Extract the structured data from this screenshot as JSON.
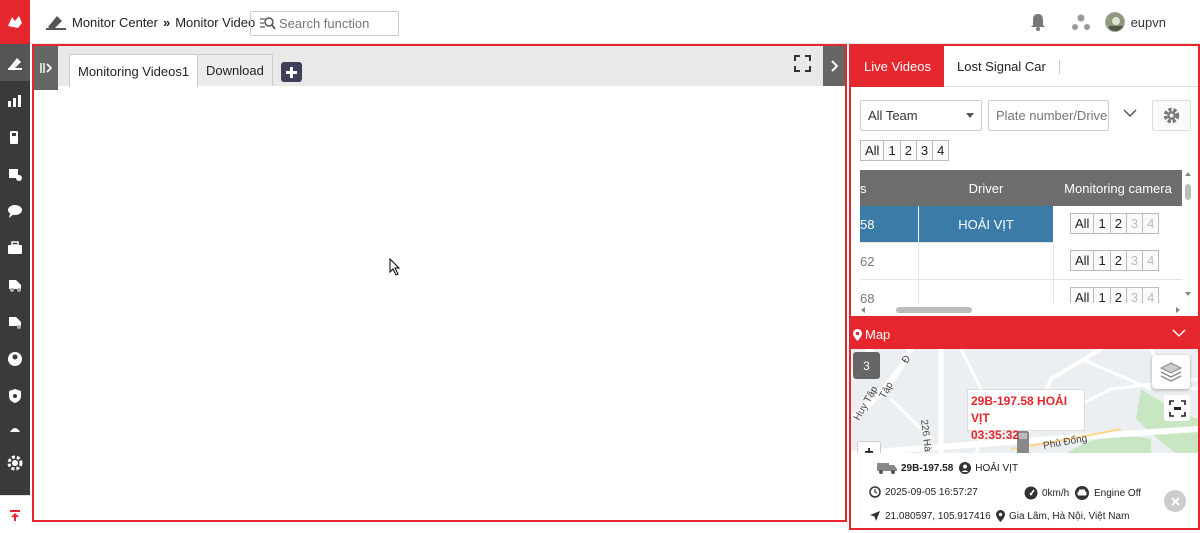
{
  "breadcrumb": {
    "section": "Monitor Center",
    "separator": "»",
    "page": "Monitor Video"
  },
  "search": {
    "placeholder": "Search function"
  },
  "user": {
    "name": "eupvn"
  },
  "main": {
    "tabs": [
      {
        "label": "Monitoring Videos1"
      },
      {
        "label": "Download"
      }
    ]
  },
  "live": {
    "tabs": [
      {
        "label": "Live Videos"
      },
      {
        "label": "Lost Signal Car"
      }
    ],
    "team_select": "All Team",
    "plate_placeholder": "Plate number/Driver",
    "channel_filters": [
      "All",
      "1",
      "2",
      "3",
      "4"
    ],
    "columns": {
      "id": "s",
      "driver": "Driver",
      "camera": "Monitoring camera"
    },
    "rows": [
      {
        "id": "58",
        "driver": "HOẢI VỊT",
        "selected": true
      },
      {
        "id": "62",
        "driver": "",
        "selected": false
      },
      {
        "id": "68",
        "driver": "",
        "selected": false
      }
    ],
    "camera_buttons": [
      "All",
      "1",
      "2",
      "3",
      "4"
    ]
  },
  "map": {
    "title": "Map",
    "cluster_count": "3",
    "street_labels": [
      "226 Hà Huy Tập",
      "Huy Tập",
      "Phù Đổng",
      "Tập",
      "Đ"
    ],
    "popup": {
      "line1": "29B-197.58 HOẢI VỊT",
      "line2": "03:35:32"
    },
    "zoom_in": "+",
    "zoom_out": "−",
    "vehicle": {
      "plate": "29B-197.58",
      "driver": "HOẢI VỊT",
      "datetime": "2025-09-05 16:57:27",
      "speed": "0km/h",
      "engine": "Engine Off",
      "coords": "21.080597, 105.917416",
      "location": "Gia Lâm, Hà Nội, Việt Nam"
    }
  },
  "colors": {
    "brand": "#e5262c",
    "sidebar": "#3a3a3a",
    "selected_row": "#3b7ba7",
    "table_header": "#6d6d6d"
  }
}
